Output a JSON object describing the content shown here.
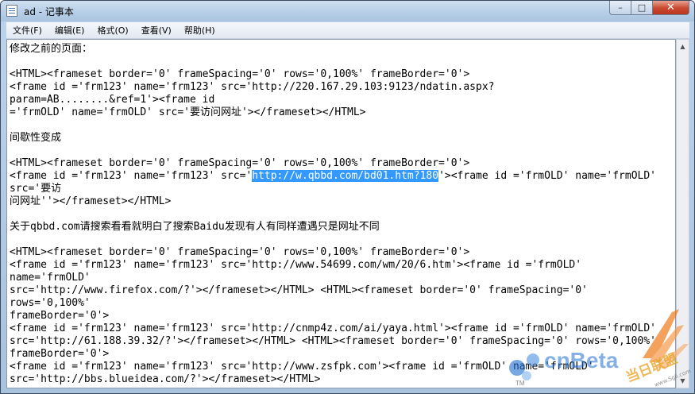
{
  "window": {
    "title": "ad - 记事本",
    "controls": {
      "minimize": "–",
      "maximize": "□",
      "close": "✕"
    },
    "app_icon": "notepad-icon"
  },
  "menu": [
    "文件(F)",
    "编辑(E)",
    "格式(O)",
    "查看(V)",
    "帮助(H)"
  ],
  "editor": {
    "lines": [
      "修改之前的页面：",
      "",
      "<HTML><frameset border='0' frameSpacing='0' rows='0,100%' frameBorder='0'>",
      "<frame id ='frm123' name='frm123' src='http://220.167.29.103:9123/ndatin.aspx?",
      "param=AB........&ref=1'><frame id",
      "='frmOLD' name='frmOLD' src='要访问网址'></frameset></HTML>",
      "",
      "间歇性变成",
      "",
      "<HTML><frameset border='0' frameSpacing='0' rows='0,100%' frameBorder='0'>",
      "",
      "src='要访",
      "问网址''></frameset></HTML>",
      "",
      "关于qbbd.com请搜索看看就明白了搜索Baidu发现有人有同样遭遇只是网址不同",
      "",
      "<HTML><frameset border='0' frameSpacing='0' rows='0,100%' frameBorder='0'>",
      "<frame id ='frm123' name='frm123' src='http://www.54699.com/wm/20/6.htm'><frame id ='frmOLD'",
      "name='frmOLD'",
      "src='http://www.firefox.com/?'></frameset></HTML> <HTML><frameset border='0' frameSpacing='0'",
      "rows='0,100%'",
      "frameBorder='0'>",
      "<frame id ='frm123' name='frm123' src='http://cnmp4z.com/ai/yaya.html'><frame id ='frmOLD' name='frmOLD'",
      "src='http://61.188.39.32/?'></frameset></HTML> <HTML><frameset border='0' frameSpacing='0' rows='0,100%'",
      "frameBorder='0'>",
      "<frame id ='frm123' name='frm123' src='http://www.zsfpk.com'><frame id ='frmOLD' name='frmOLD'",
      "src='http://bbs.blueidea.com/?'></frameset></HTML>"
    ],
    "selected_line": {
      "before": "<frame id ='frm123' name='frm123' src='",
      "selected": "http://w.qbbd.com/bd01.htm?180",
      "after": "'><frame id ='frmOLD' name='frmOLD'"
    }
  },
  "watermark": {
    "brand": "cnBeta",
    "suffix": "TM",
    "chinese": "当日联盟",
    "url": "www.Sgli.com"
  },
  "colors": {
    "selection": "#3399ff",
    "titlebar": "#bcd3ea",
    "close_button": "#c9482f",
    "watermark_blue": "#1f6fd0",
    "watermark_orange": "#f07a1a"
  }
}
